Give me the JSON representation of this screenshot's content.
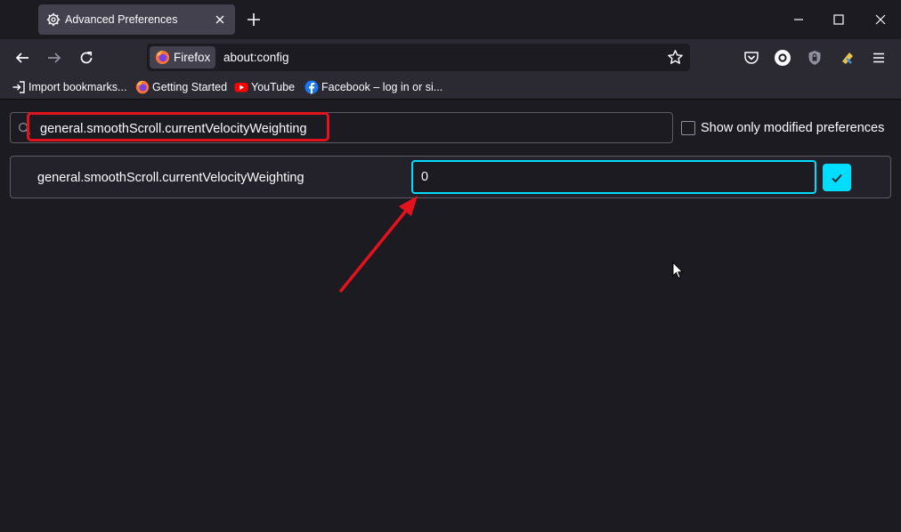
{
  "tab": {
    "title": "Advanced Preferences"
  },
  "urlbar": {
    "identity_label": "Firefox",
    "url": "about:config"
  },
  "bookmarks": [
    {
      "label": "Import bookmarks...",
      "icon": "import-icon"
    },
    {
      "label": "Getting Started",
      "icon": "firefox-icon"
    },
    {
      "label": "YouTube",
      "icon": "youtube-icon"
    },
    {
      "label": "Facebook – log in or si...",
      "icon": "facebook-icon"
    }
  ],
  "config": {
    "search_value": "general.smoothScroll.currentVelocityWeighting",
    "show_modified_label": "Show only modified preferences",
    "show_modified_checked": false,
    "pref_name": "general.smoothScroll.currentVelocityWeighting",
    "pref_value": "0"
  },
  "colors": {
    "accent": "#00ddff",
    "annotation_red": "#e3121c",
    "background": "#1c1b22",
    "toolbar": "#2b2a33"
  }
}
